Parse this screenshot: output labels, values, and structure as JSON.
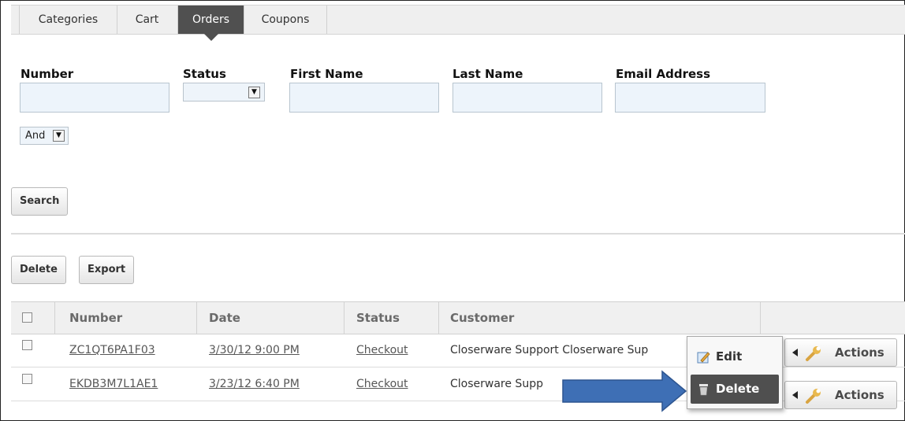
{
  "tabs": [
    "Categories",
    "Cart",
    "Orders",
    "Coupons"
  ],
  "active_tab": "Orders",
  "filters": {
    "number_label": "Number",
    "status_label": "Status",
    "first_name_label": "First Name",
    "last_name_label": "Last Name",
    "email_label": "Email Address",
    "number_value": "",
    "first_name_value": "",
    "last_name_value": "",
    "email_value": "",
    "status_value": "",
    "operator_value": "And"
  },
  "buttons": {
    "search": "Search",
    "delete": "Delete",
    "export": "Export"
  },
  "table": {
    "headers": [
      "Number",
      "Date",
      "Status",
      "Customer"
    ],
    "rows": [
      {
        "number": "ZC1QT6PA1F03",
        "date": "3/30/12 9:00 PM",
        "status": "Checkout",
        "customer": "Closerware Support Closerware Sup"
      },
      {
        "number": "EKDB3M7L1AE1",
        "date": "3/23/12 6:40 PM",
        "status": "Checkout",
        "customer": "Closerware Supp"
      }
    ],
    "actions_label": "Actions"
  },
  "context_menu": {
    "items": [
      "Edit",
      "Delete"
    ],
    "highlighted": "Delete"
  },
  "colors": {
    "tab_active": "#505050",
    "input_bg": "#edf4fb",
    "arrow": "#3e6fb5",
    "link": "#565656"
  }
}
